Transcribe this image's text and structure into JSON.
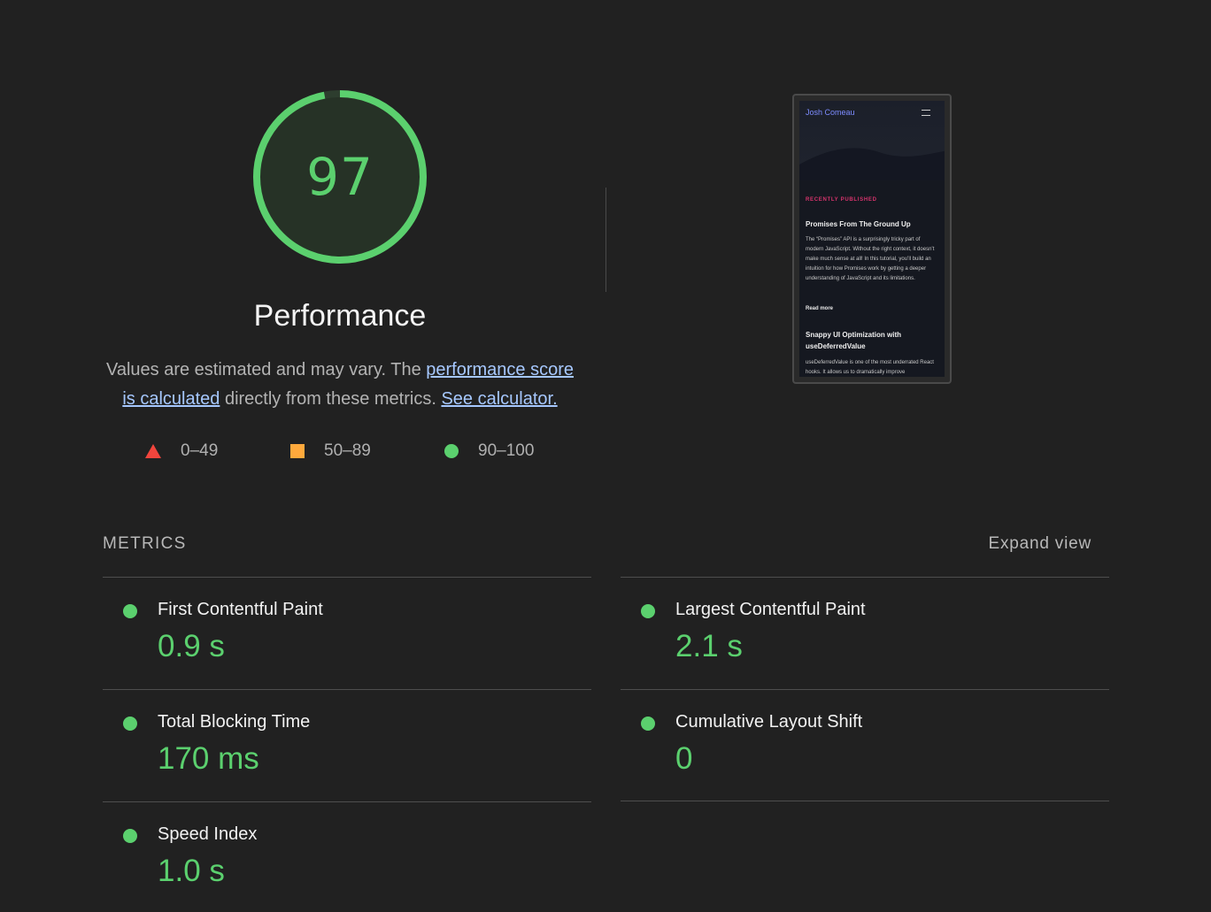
{
  "gauge": {
    "score": "97",
    "score_fraction": 0.97,
    "color": "#5bd06e",
    "title": "Performance"
  },
  "description": {
    "text_before": "Values are estimated and may vary. The ",
    "link_score": "performance score is calculated",
    "text_middle": " directly from these metrics. ",
    "link_calculator": "See calculator."
  },
  "legend": [
    {
      "shape": "triangle-icon",
      "range": "0–49",
      "color": "#f2453d"
    },
    {
      "shape": "square-icon",
      "range": "50–89",
      "color": "#ffa93c"
    },
    {
      "shape": "circle-icon",
      "range": "90–100",
      "color": "#5bd06e"
    }
  ],
  "screenshot": {
    "logo": "Josh Comeau",
    "section": "RECENTLY PUBLISHED",
    "post1_title": "Promises From The Ground Up",
    "post1_excerpt": "The “Promises” API is a surprisingly tricky part of modern JavaScript. Without the right context, it doesn’t make much sense at all! In this tutorial, you’ll build an intuition for how Promises work by getting a deeper understanding of JavaScript and its limitations.",
    "read_more": "Read more",
    "post2_title": "Snappy UI Optimization with useDeferredValue",
    "post2_excerpt": "useDeferredValue is one of the most underrated React hooks. It allows us to dramatically improve"
  },
  "metrics": {
    "header": "METRICS",
    "expand_label": "Expand view",
    "items": [
      {
        "title": "First Contentful Paint",
        "value": "0.9 s"
      },
      {
        "title": "Largest Contentful Paint",
        "value": "2.1 s"
      },
      {
        "title": "Total Blocking Time",
        "value": "170 ms"
      },
      {
        "title": "Cumulative Layout Shift",
        "value": "0"
      },
      {
        "title": "Speed Index",
        "value": "1.0 s"
      }
    ]
  }
}
